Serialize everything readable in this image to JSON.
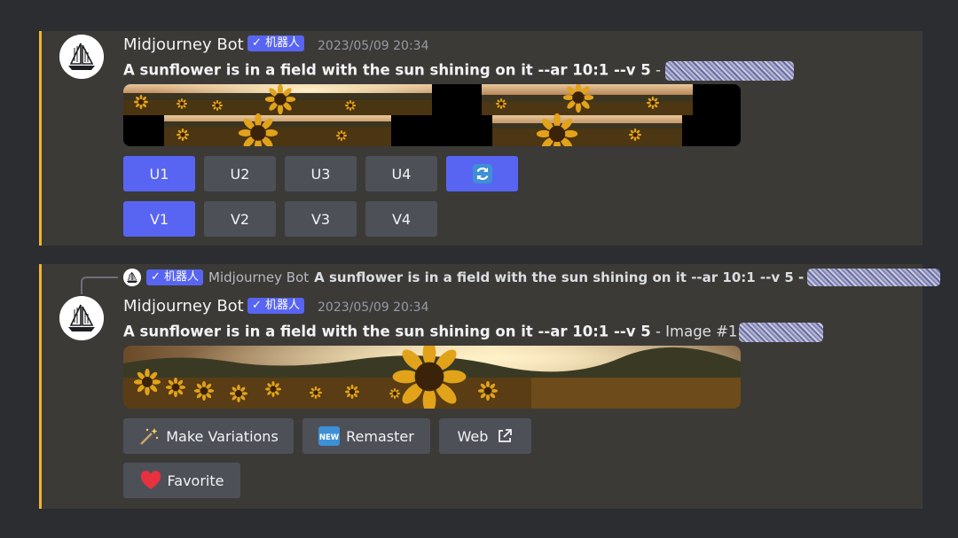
{
  "message1": {
    "author": "Midjourney Bot",
    "bot_badge": "✓ 机器人",
    "timestamp": "2023/05/09 20:34",
    "prompt": "A sunflower is in a field with the sun shining on it --ar 10:1 --v 5",
    "prompt_suffix": " - ",
    "upscale_buttons": [
      "U1",
      "U2",
      "U3",
      "U4"
    ],
    "variation_buttons": [
      "V1",
      "V2",
      "V3",
      "V4"
    ],
    "selected": [
      "U1",
      "V1"
    ]
  },
  "message2": {
    "reply": {
      "badge": "✓ 机器人",
      "author": "Midjourney Bot",
      "text": "A sunflower is in a field with the sun shining on it --ar 10:1 --v 5 -"
    },
    "author": "Midjourney Bot",
    "bot_badge": "✓ 机器人",
    "timestamp": "2023/05/09 20:34",
    "prompt": "A sunflower is in a field with the sun shining on it --ar 10:1 --v 5",
    "prompt_suffix": " - Image #1",
    "buttons": {
      "make_variations": "Make Variations",
      "remaster": "Remaster",
      "remaster_badge": "NEW",
      "web": "Web",
      "favorite": "Favorite"
    }
  },
  "colors": {
    "accent": "#5865f2",
    "highlight_bar": "#f0b232",
    "button_gray": "#4e5058",
    "message_bg": "#3c3a37",
    "page_bg": "#2b2d31"
  }
}
